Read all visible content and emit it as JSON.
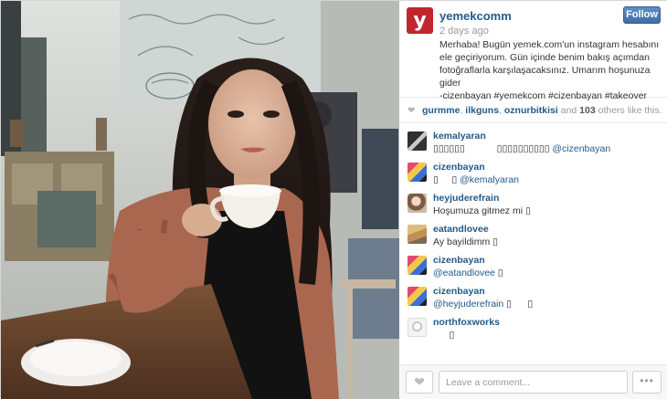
{
  "post": {
    "username": "yemekcomm",
    "avatar_letter": "y",
    "age": "2 days ago",
    "follow_label": "Follow",
    "caption": "Merhaba! Bugün yemek.com'un instagram hesabını ele geçiriyorum. Gün içinde benim bakış açımdan fotoğraflarla karşılaşacaksınız. Umarım hoşunuza gider\n        -cizenbayan #yemekcom #cizenbayan #takeover",
    "brand_color": "#c1262f"
  },
  "likes": {
    "heart_icon": "heart-icon",
    "users": [
      "gurmme",
      "ilkguns",
      "oznurbitkisi"
    ],
    "sep1": ", ",
    "sep2": ", ",
    "and_text": " and ",
    "count": "103",
    "tail": " others like this."
  },
  "comments": [
    {
      "user": "kemalyaran",
      "pre": "▯▯▯▯▯▯            ▯▯▯▯▯▯▯▯▯▯ ",
      "mention": "@cizenbayan",
      "post": ""
    },
    {
      "user": "cizenbayan",
      "pre": "▯     ▯ ",
      "mention": "@kemalyaran",
      "post": ""
    },
    {
      "user": "heyjuderefrain",
      "pre": "Hoşumuza gitmez mi ▯",
      "mention": "",
      "post": ""
    },
    {
      "user": "eatandlovee",
      "pre": "Ay bayildimm ▯",
      "mention": "",
      "post": ""
    },
    {
      "user": "cizenbayan",
      "pre": "",
      "mention": "@eatandlovee",
      "post": " ▯"
    },
    {
      "user": "cizenbayan",
      "pre": "",
      "mention": "@heyjuderefrain",
      "post": " ▯      ▯"
    },
    {
      "user": "northfoxworks",
      "pre": "      ▯",
      "mention": "",
      "post": ""
    }
  ],
  "footer": {
    "comment_placeholder": "Leave a comment...",
    "more_label": "•••"
  },
  "colors": {
    "link": "#215a8c",
    "follow_button": "#4a7bb5"
  }
}
